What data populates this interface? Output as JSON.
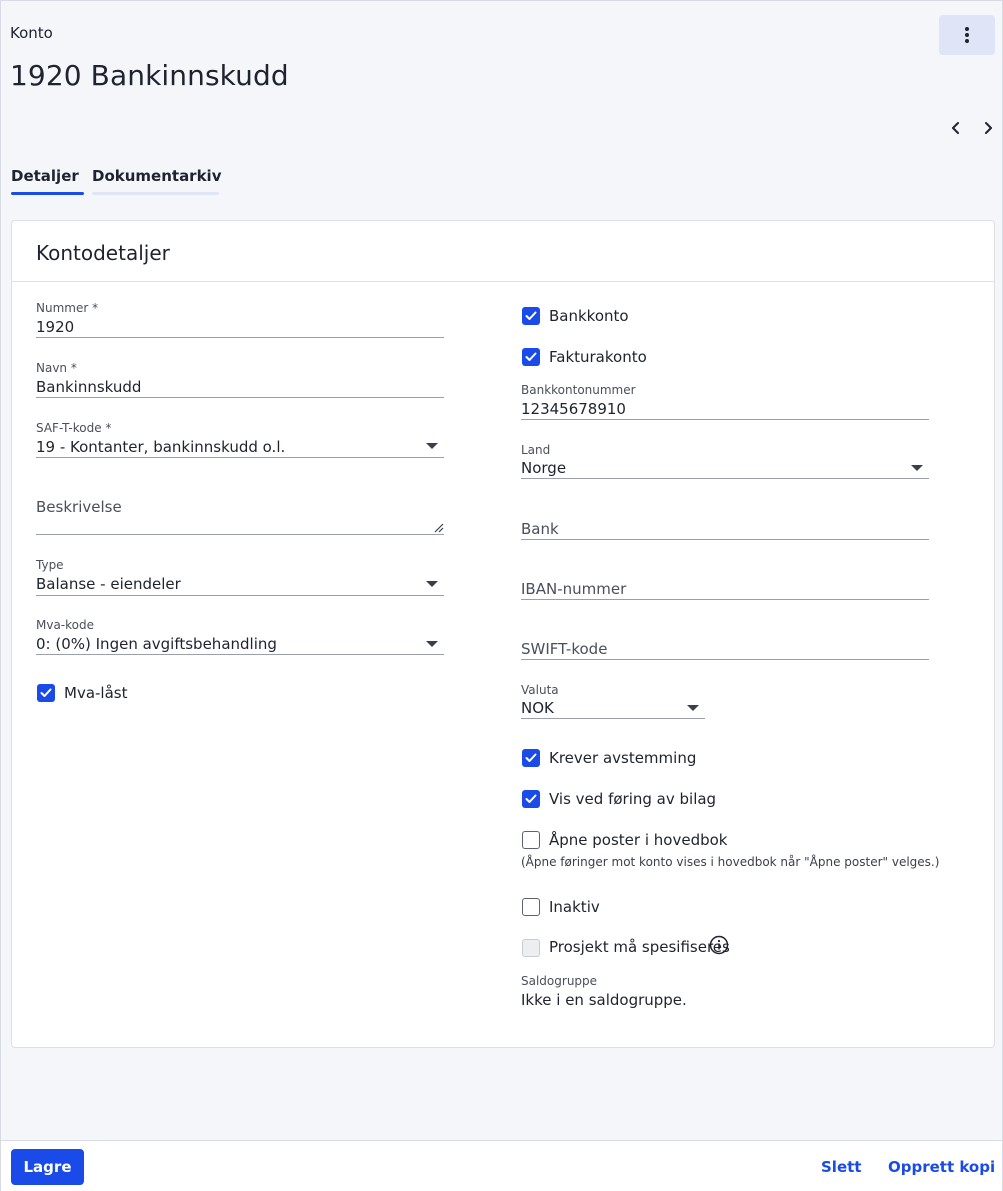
{
  "header": {
    "breadcrumb": "Konto",
    "title": "1920 Bankinnskudd",
    "menu_icon": "more-vertical-icon",
    "prev_icon": "chevron-left-icon",
    "next_icon": "chevron-right-icon"
  },
  "tabs": [
    {
      "label": "Detaljer",
      "active": true
    },
    {
      "label": "Dokumentarkiv",
      "active": false
    }
  ],
  "card": {
    "title": "Kontodetaljer"
  },
  "left": {
    "nummer": {
      "label": "Nummer *",
      "value": "1920"
    },
    "navn": {
      "label": "Navn *",
      "value": "Bankinnskudd"
    },
    "saft": {
      "label": "SAF-T-kode *",
      "value": "19 - Kontanter, bankinnskudd o.l."
    },
    "beskrivelse": {
      "placeholder": "Beskrivelse"
    },
    "type": {
      "label": "Type",
      "value": "Balanse - eiendeler"
    },
    "mva_kode": {
      "label": "Mva-kode",
      "value": "0: (0%) Ingen avgiftsbehandling"
    },
    "mva_last": {
      "label": "Mva-låst",
      "checked": true
    }
  },
  "right": {
    "bankkonto": {
      "label": "Bankkonto",
      "checked": true
    },
    "fakturakonto": {
      "label": "Fakturakonto",
      "checked": true
    },
    "bankkontonummer": {
      "label": "Bankkontonummer",
      "value": "12345678910"
    },
    "land": {
      "label": "Land",
      "value": "Norge"
    },
    "bank": {
      "placeholder": "Bank"
    },
    "iban": {
      "placeholder": "IBAN-nummer"
    },
    "swift": {
      "placeholder": "SWIFT-kode"
    },
    "valuta": {
      "label": "Valuta",
      "value": "NOK"
    },
    "krever_avstemming": {
      "label": "Krever avstemming",
      "checked": true
    },
    "vis_ved_foring": {
      "label": "Vis ved føring av bilag",
      "checked": true
    },
    "apne_poster": {
      "label": "Åpne poster i hovedbok",
      "checked": false,
      "hint": "(Åpne føringer mot konto vises i hovedbok når \"Åpne poster\" velges.)"
    },
    "inaktiv": {
      "label": "Inaktiv",
      "checked": false
    },
    "prosjekt": {
      "label": "Prosjekt må spesifiseres",
      "checked": false,
      "disabled": true,
      "info_icon": "info-icon"
    },
    "saldogruppe": {
      "label": "Saldogruppe",
      "value": "Ikke i en saldogruppe."
    }
  },
  "footer": {
    "save_label": "Lagre",
    "delete_label": "Slett",
    "copy_label": "Opprett kopi"
  },
  "colors": {
    "accent": "#1a4be8",
    "menu_button_bg": "#dfe4f7",
    "page_bg": "#f5f6fa"
  }
}
